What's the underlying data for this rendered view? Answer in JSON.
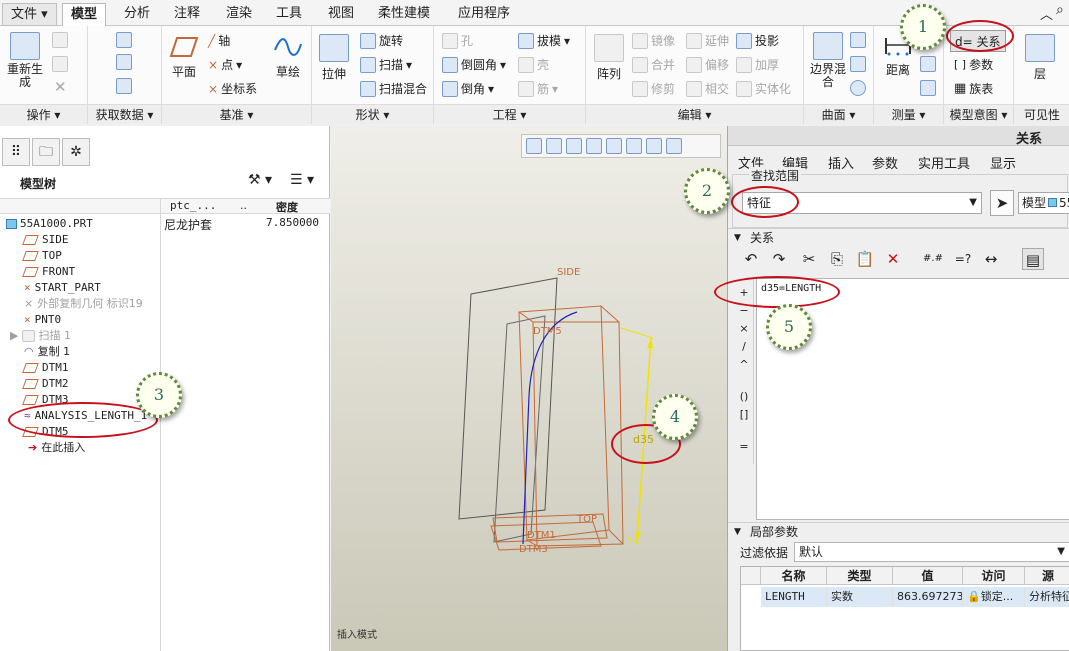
{
  "menubar": {
    "file": "文件",
    "tabs": [
      "模型",
      "分析",
      "注释",
      "渲染",
      "工具",
      "视图",
      "柔性建模",
      "应用程序"
    ]
  },
  "ribbon": {
    "groups": {
      "operations": "操作",
      "get_data": "获取数据",
      "datum": "基准",
      "shapes": "形状",
      "engineering": "工程",
      "editing": "编辑",
      "surface": "曲面",
      "measure": "测量",
      "model_intent": "模型意图",
      "visibility": "可见性"
    },
    "operations": {
      "regenerate": "重新生成"
    },
    "datum": {
      "plane": "平面",
      "axis": "轴",
      "point": "点",
      "csys": "坐标系",
      "sketch": "草绘"
    },
    "shapes": {
      "extrude": "拉伸",
      "revolve": "旋转",
      "sweep": "扫描",
      "swept_blend": "扫描混合"
    },
    "engineering": {
      "hole": "孔",
      "draft": "拔模",
      "round": "倒圆角",
      "shell": "壳",
      "chamfer": "倒角",
      "rib": "筋"
    },
    "editing": {
      "pattern": "阵列",
      "mirror": "镜像",
      "extend": "延伸",
      "project": "投影",
      "merge": "合并",
      "offset": "偏移",
      "thicken": "加厚",
      "trim": "修剪",
      "intersect": "相交",
      "solidify": "实体化"
    },
    "surface": {
      "boundary_blend": "边界混合"
    },
    "measure": {
      "distance": "距离"
    },
    "model_intent": {
      "relations": "d= 关系",
      "parameters": "参数",
      "family_table": "族表"
    },
    "visibility": {
      "layers": "层"
    }
  },
  "model_tree": {
    "title": "模型树",
    "columns": {
      "param": "ptc_...",
      "dots": "..",
      "density": "密度"
    },
    "part_name": "55A1000.PRT",
    "part_param": "尼龙护套",
    "part_density": "7.850000",
    "items": [
      "SIDE",
      "TOP",
      "FRONT",
      "START_PART",
      "外部复制几何 标识19",
      "PNT0",
      "扫描 1",
      "复制 1",
      "DTM1",
      "DTM2",
      "DTM3",
      "ANALYSIS_LENGTH_1",
      "DTM5",
      "在此插入"
    ]
  },
  "viewport": {
    "status": "插入模式",
    "labels": {
      "side": "SIDE",
      "top": "TOP",
      "dtm1": "DTM1",
      "dtm3": "DTM3",
      "dtm5": "DTM5",
      "dim": "d35"
    }
  },
  "dialog": {
    "title": "关系",
    "menu": [
      "文件",
      "编辑",
      "插入",
      "参数",
      "实用工具",
      "显示"
    ],
    "lookup_section": "查找范围",
    "lookup_value": "特征",
    "model_label": "模型",
    "model_value": "55",
    "relations_section": "关系",
    "relation_text": "d35=LENGTH",
    "local_params_section": "局部参数",
    "filter_label": "过滤依据",
    "filter_value": "默认",
    "columns": [
      "名称",
      "类型",
      "值",
      "访问",
      "源"
    ],
    "rows": [
      {
        "name": "LENGTH",
        "type": "实数",
        "value": "863.697273",
        "access": "锁定...",
        "source": "分析特征"
      }
    ]
  },
  "callouts": [
    "1",
    "2",
    "3",
    "4",
    "5"
  ],
  "colors": {
    "callout_ring": "#c8101a",
    "callout_bubble_border": "#5e8b3a",
    "datum_orange": "#c26a3a",
    "dimension_yellow": "#f0e200",
    "curve_blue": "#2222bb"
  }
}
